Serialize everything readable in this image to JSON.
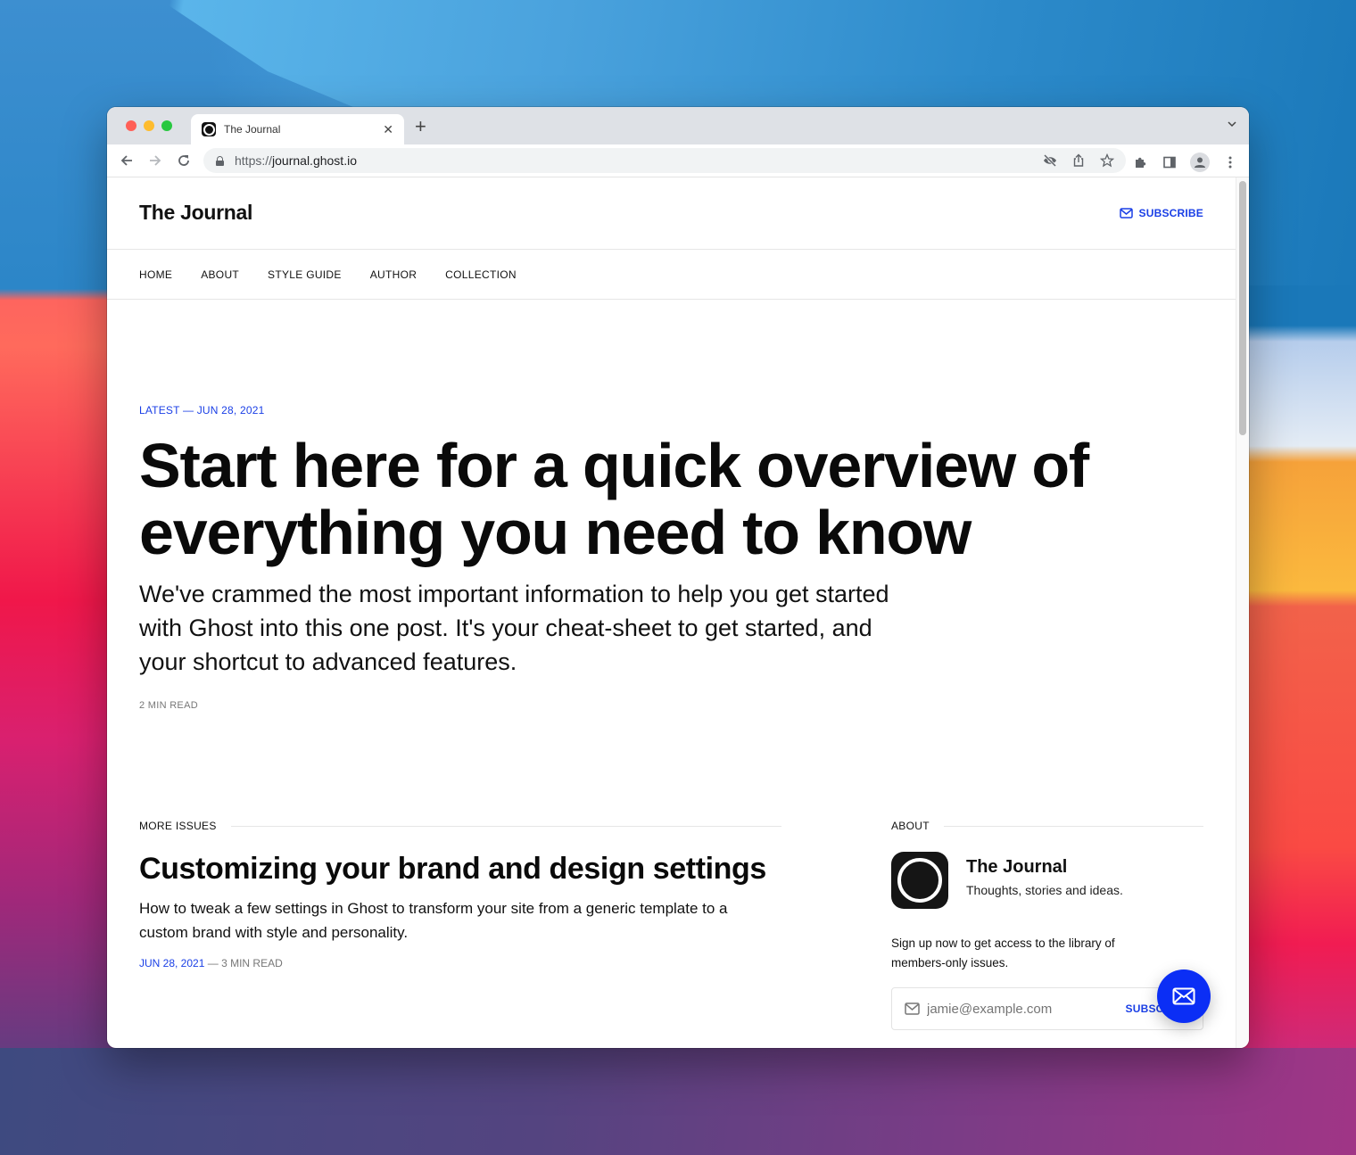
{
  "browser": {
    "tab": {
      "title": "The Journal",
      "favicon": "ghost-circle-icon"
    },
    "url": {
      "scheme": "https://",
      "host": "journal.ghost.io"
    },
    "icons": {
      "back": "arrow-left-icon",
      "forward": "arrow-right-icon",
      "reload": "reload-icon",
      "omnibox": [
        "eye-off-icon",
        "share-icon",
        "star-icon"
      ],
      "extensions": [
        "puzzle-icon",
        "sidepanel-icon",
        "profile-icon",
        "kebab-menu-icon"
      ]
    }
  },
  "site": {
    "title": "The Journal",
    "subscribe_label": "SUBSCRIBE",
    "nav": [
      "HOME",
      "ABOUT",
      "STYLE GUIDE",
      "AUTHOR",
      "COLLECTION"
    ],
    "accent_color": "#1a3fe6"
  },
  "hero": {
    "meta": "LATEST — JUN 28, 2021",
    "title": "Start here for a quick overview of everything you need to know",
    "excerpt": "We've crammed the most important information to help you get started with Ghost into this one post. It's your cheat-sheet to get started, and your shortcut to advanced features.",
    "read_time": "2 MIN READ"
  },
  "more_issues": {
    "heading": "MORE ISSUES",
    "posts": [
      {
        "title": "Customizing your brand and design settings",
        "excerpt": "How to tweak a few settings in Ghost to transform your site from a generic template to a custom brand with style and personality.",
        "date": "JUN 28, 2021",
        "separator": " — ",
        "read_time": "3 MIN READ"
      }
    ]
  },
  "about": {
    "heading": "ABOUT",
    "name": "The Journal",
    "description": "Thoughts, stories and ideas.",
    "cta": "Sign up now to get access to the library of members-only issues.",
    "email_placeholder": "jamie@example.com",
    "button_label": "SUBSCRIBE"
  },
  "portal": {
    "icon": "envelope-icon",
    "color": "#0b2ef5"
  }
}
